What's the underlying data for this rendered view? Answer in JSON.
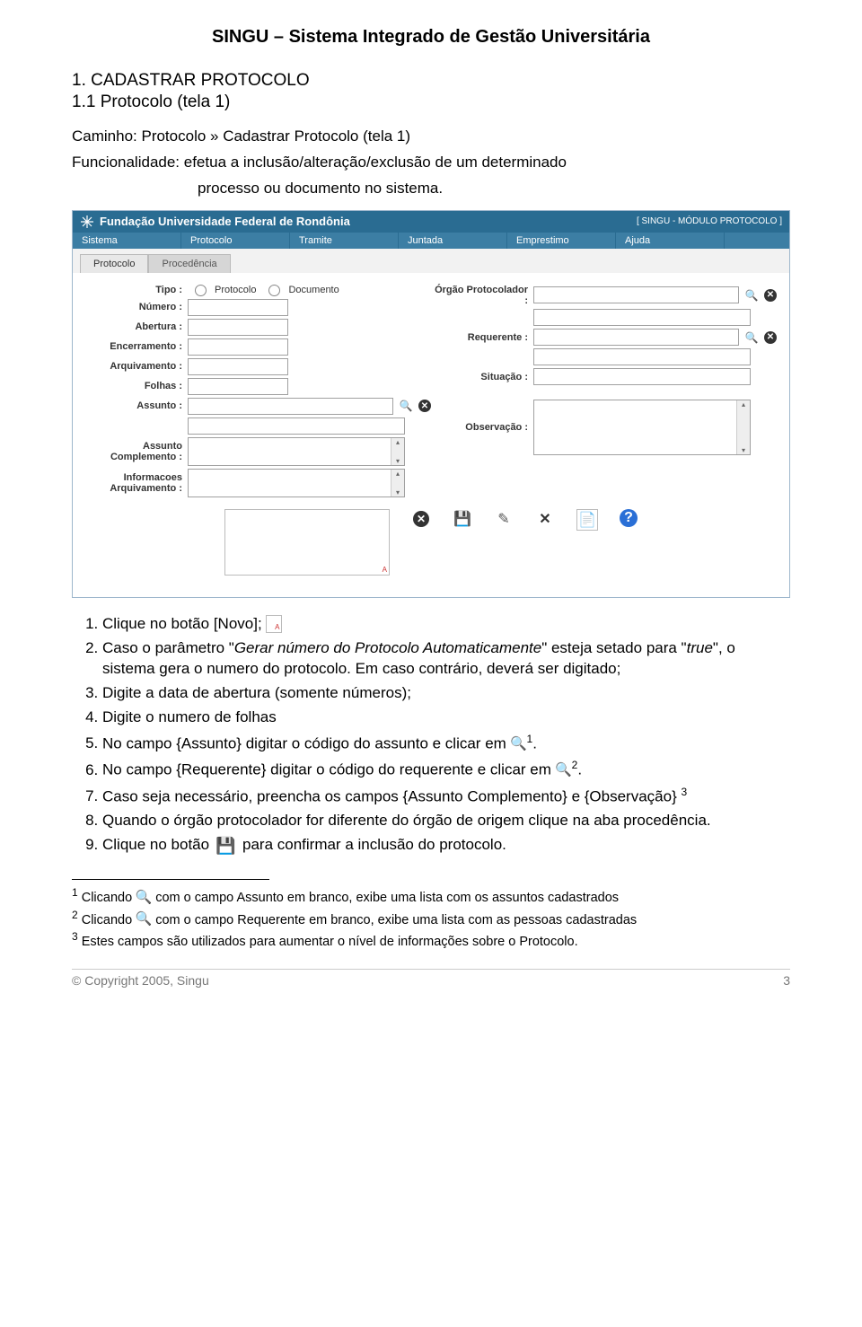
{
  "title": "SINGU – Sistema Integrado de Gestão Universitária",
  "section": {
    "h1": "1. CADASTRAR PROTOCOLO",
    "h2": "1.1 Protocolo (tela 1)"
  },
  "path_label": "Caminho: Protocolo » Cadastrar Protocolo (tela 1)",
  "func_label": "Funcionalidade: efetua a inclusão/alteração/exclusão de um determinado",
  "func_cont": "processo ou documento no sistema.",
  "screenshot": {
    "org": "Fundação Universidade Federal de Rondônia",
    "module": "[ SINGU - MÓDULO PROTOCOLO ]",
    "menu": [
      "Sistema",
      "Protocolo",
      "Tramite",
      "Juntada",
      "Emprestimo",
      "Ajuda"
    ],
    "tabs": [
      "Protocolo",
      "Procedência"
    ],
    "labels": {
      "tipo": "Tipo :",
      "protocolo": "Protocolo",
      "documento": "Documento",
      "numero": "Número :",
      "abertura": "Abertura :",
      "encerramento": "Encerramento :",
      "arquivamento": "Arquivamento :",
      "folhas": "Folhas :",
      "assunto": "Assunto :",
      "assunto_comp": "Assunto Complemento :",
      "info_arq": "Informacoes Arquivamento :",
      "orgao_prot": "Órgão Protocolador :",
      "requerente": "Requerente :",
      "situacao": "Situação :",
      "observacao": "Observação :"
    }
  },
  "steps": {
    "s1a": "Clique no botão [Novo];",
    "s2": "Caso o parâmetro \"Gerar número do Protocolo Automaticamente\" esteja setado para \"true\", o sistema gera o numero do protocolo. Em caso contrário, deverá ser digitado;",
    "s2_italic_a": "Gerar número do Protocolo Automaticamente",
    "s2_italic_b": "true",
    "s3": "Digite a data de abertura (somente números);",
    "s4": "Digite o numero de folhas",
    "s5": "No campo {Assunto} digitar o código do assunto e clicar em",
    "s6": "No campo {Requerente} digitar o código do requerente e clicar em",
    "s7": "Caso seja necessário, preencha os campos {Assunto Complemento} e {Observação}",
    "s8": "Quando o órgão protocolador for diferente do órgão de origem clique na aba procedência.",
    "s9a": "Clique no botão",
    "s9b": "para confirmar a inclusão do protocolo."
  },
  "footnotes": {
    "f1a": "Clicando",
    "f1b": "com o campo Assunto em branco, exibe uma lista com os assuntos cadastrados",
    "f2a": "Clicando",
    "f2b": "com o campo Requerente em branco, exibe uma lista com as pessoas cadastradas",
    "f3": "Estes campos são utilizados para aumentar o nível de informações sobre o Protocolo."
  },
  "footer": {
    "left": "© Copyright 2005, Singu",
    "right": "3"
  }
}
